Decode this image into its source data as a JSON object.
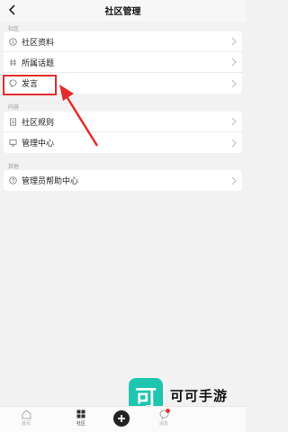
{
  "header": {
    "title": "社区管理"
  },
  "sections": [
    {
      "label": "社区",
      "items": [
        {
          "label": "社区资料",
          "icon": "info-icon"
        },
        {
          "label": "所属话题",
          "icon": "topic-icon"
        },
        {
          "label": "发言",
          "icon": "speech-bubble-icon"
        }
      ]
    },
    {
      "label": "内容",
      "items": [
        {
          "label": "社区规则",
          "icon": "document-icon"
        },
        {
          "label": "管理中心",
          "icon": "monitor-icon"
        }
      ]
    },
    {
      "label": "其他",
      "items": [
        {
          "label": "管理员帮助中心",
          "icon": "help-icon"
        }
      ]
    }
  ],
  "bottom_nav": {
    "home_label": "首页",
    "community_label": "社区",
    "message_label": "消息"
  },
  "watermark": {
    "logo": "可",
    "text": "可可手游"
  },
  "colors": {
    "highlight": "#e52b2b",
    "brand": "#1ec6b0"
  }
}
